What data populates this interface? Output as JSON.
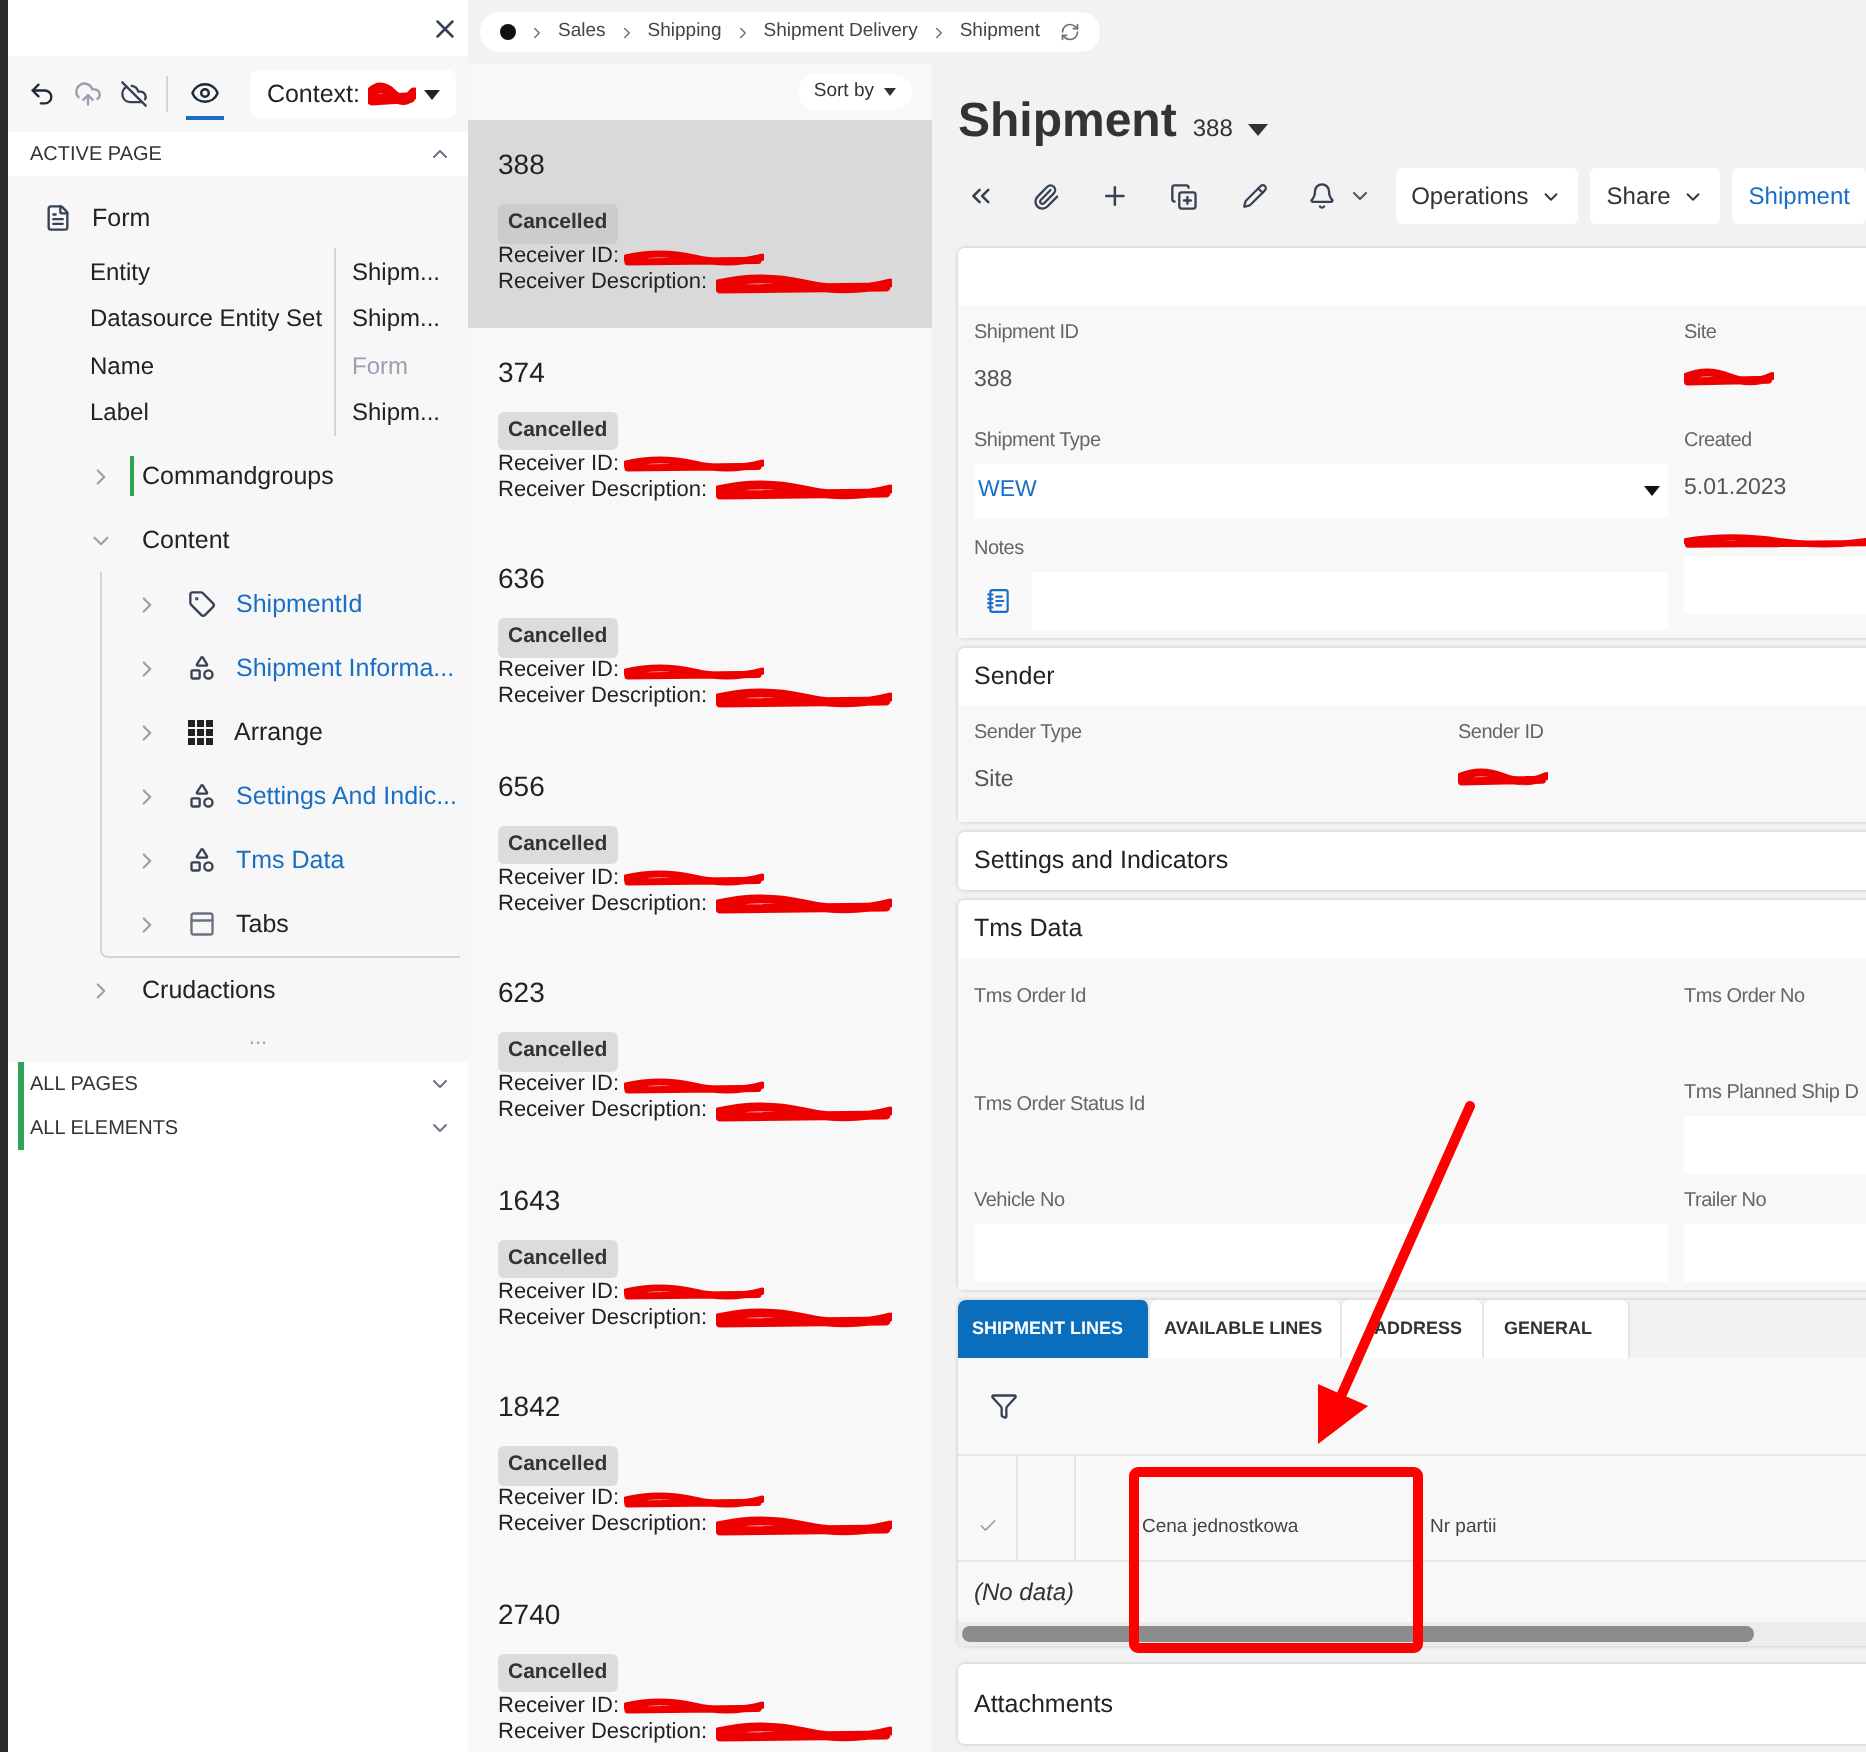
{
  "panel": {
    "context_label": "Context:",
    "sections": [
      {
        "title": "ACTIVE PAGE",
        "expanded": true,
        "modified": false
      },
      {
        "title": "ALL PAGES",
        "expanded": false,
        "modified": true
      },
      {
        "title": "ALL ELEMENTS",
        "expanded": false,
        "modified": true
      }
    ],
    "root": {
      "label": "Form",
      "properties": [
        {
          "name": "Entity",
          "value": "Shipm...",
          "muted": false
        },
        {
          "name": "Datasource Entity Set",
          "value": "Shipm...",
          "muted": false
        },
        {
          "name": "Name",
          "value": "Form",
          "muted": true
        },
        {
          "name": "Label",
          "value": "Shipm...",
          "muted": false
        }
      ]
    },
    "tree": [
      {
        "label": "Commandgroups",
        "kind": "folder",
        "expanded": false,
        "modified": true
      },
      {
        "label": "Content",
        "kind": "folder",
        "expanded": true,
        "modified": false,
        "children": [
          {
            "label": "ShipmentId",
            "kind": "field",
            "expanded": false,
            "modified": false
          },
          {
            "label": "Shipment Informa...",
            "kind": "group",
            "expanded": false,
            "modified": false
          },
          {
            "label": "Arrange",
            "kind": "arrange",
            "expanded": false,
            "modified": false
          },
          {
            "label": "Settings And Indic...",
            "kind": "group",
            "expanded": false,
            "modified": false
          },
          {
            "label": "Tms Data",
            "kind": "group",
            "expanded": false,
            "modified": false
          },
          {
            "label": "Tabs",
            "kind": "tabs",
            "expanded": false,
            "modified": false
          }
        ]
      },
      {
        "label": "Crudactions",
        "kind": "folder",
        "expanded": false,
        "modified": false
      }
    ],
    "more": "..."
  },
  "breadcrumb": [
    "Sales",
    "Shipping",
    "Shipment Delivery",
    "Shipment"
  ],
  "list": {
    "sort_label": "Sort by",
    "items": [
      {
        "number": "388",
        "status": "Cancelled",
        "receiver_id": "Receiver ID:",
        "receiver_description": "Receiver Description:",
        "selected": true
      },
      {
        "number": "374",
        "status": "Cancelled",
        "receiver_id": "Receiver ID:",
        "receiver_description": "Receiver Description:",
        "selected": false
      },
      {
        "number": "636",
        "status": "Cancelled",
        "receiver_id": "Receiver ID:",
        "receiver_description": "Receiver Description:",
        "selected": false
      },
      {
        "number": "656",
        "status": "Cancelled",
        "receiver_id": "Receiver ID:",
        "receiver_description": "Receiver Description:",
        "selected": false
      },
      {
        "number": "623",
        "status": "Cancelled",
        "receiver_id": "Receiver ID:",
        "receiver_description": "Receiver Description:",
        "selected": false
      },
      {
        "number": "1643",
        "status": "Cancelled",
        "receiver_id": "Receiver ID:",
        "receiver_description": "Receiver Description:",
        "selected": false
      },
      {
        "number": "1842",
        "status": "Cancelled",
        "receiver_id": "Receiver ID:",
        "receiver_description": "Receiver Description:",
        "selected": false
      },
      {
        "number": "2740",
        "status": "Cancelled",
        "receiver_id": "Receiver ID:",
        "receiver_description": "Receiver Description:",
        "selected": false
      }
    ]
  },
  "detail": {
    "title": "Shipment",
    "record": "388",
    "toolbar": [
      {
        "label": "Operations",
        "kind": "menu"
      },
      {
        "label": "Share",
        "kind": "menu"
      },
      {
        "label": "Shipment",
        "kind": "link"
      }
    ],
    "cards": [
      {
        "fields": [
          {
            "label": "Shipment ID",
            "kind": "text",
            "value": "388"
          },
          {
            "label": "Site",
            "kind": "redacted"
          },
          {
            "label": "Shipment Type",
            "kind": "select",
            "value": "WEW"
          },
          {
            "label": "Created",
            "kind": "text",
            "value": "5.01.2023"
          },
          {
            "label": "Notes",
            "kind": "notes"
          },
          {
            "kind": "redacted_label_input"
          }
        ]
      },
      {
        "title": "Sender",
        "fields": [
          {
            "label": "Sender Type",
            "kind": "text",
            "value": "Site"
          },
          {
            "label": "Sender ID",
            "kind": "redacted"
          }
        ]
      },
      {
        "title": "Settings and Indicators"
      },
      {
        "title": "Tms Data",
        "fields": [
          {
            "label": "Tms Order Id",
            "kind": "empty"
          },
          {
            "label": "Tms Order No",
            "kind": "empty"
          },
          {
            "label": "Tms Order Status Id",
            "kind": "empty"
          },
          {
            "label": "Tms Planned Ship D",
            "kind": "input"
          },
          {
            "label": "Vehicle No",
            "kind": "input"
          },
          {
            "label": "Trailer No",
            "kind": "input"
          }
        ]
      }
    ],
    "tabs": [
      {
        "label": "SHIPMENT LINES",
        "selected": true
      },
      {
        "label": "AVAILABLE LINES",
        "selected": false
      },
      {
        "label": "ADDRESS",
        "selected": false
      },
      {
        "label": "GENERAL",
        "selected": false
      }
    ],
    "table": {
      "columns": [
        "Cena jednostkowa",
        "Nr partii"
      ],
      "empty_text": "(No data)"
    },
    "attachments_title": "Attachments"
  }
}
